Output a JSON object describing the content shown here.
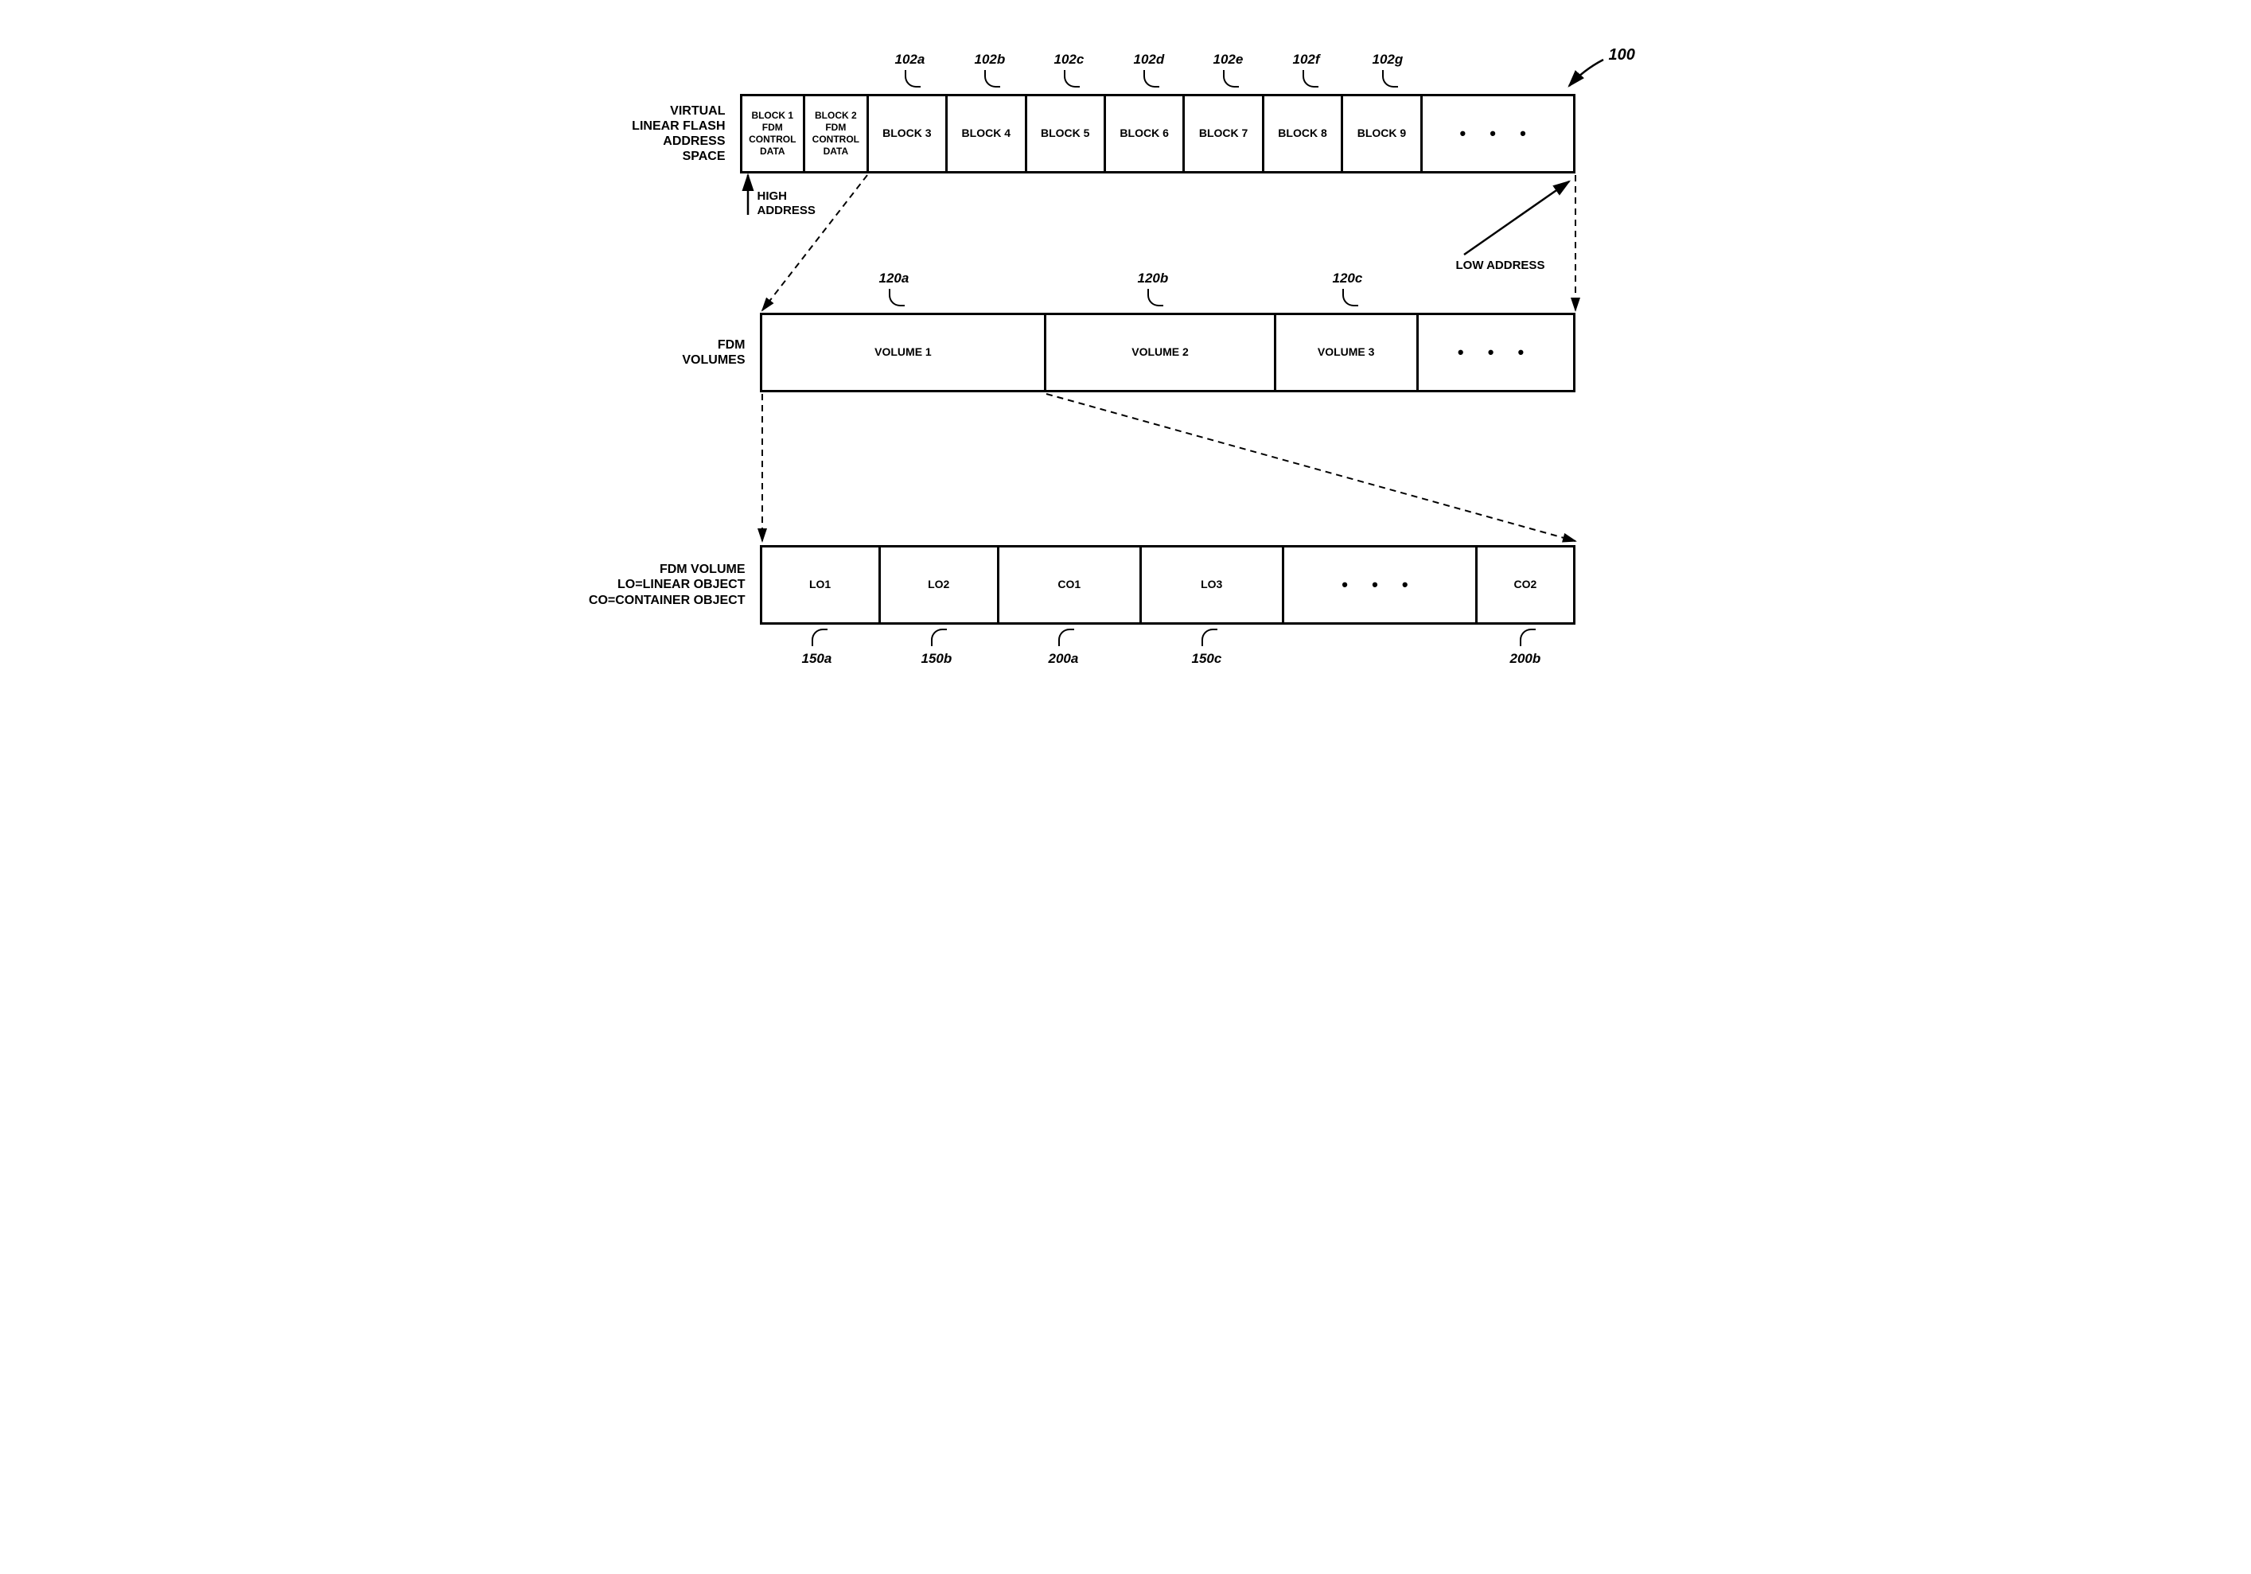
{
  "figure_ref": "100",
  "row1": {
    "label": "VIRTUAL\nLINEAR FLASH\nADDRESS\nSPACE",
    "cells": [
      "BLOCK 1\nFDM\nCONTROL\nDATA",
      "BLOCK 2\nFDM\nCONTROL\nDATA",
      "BLOCK 3",
      "BLOCK 4",
      "BLOCK 5",
      "BLOCK 6",
      "BLOCK 7",
      "BLOCK 8",
      "BLOCK 9"
    ],
    "callouts": [
      "102a",
      "102b",
      "102c",
      "102d",
      "102e",
      "102f",
      "102g"
    ],
    "high_addr": "HIGH\nADDRESS",
    "low_addr": "LOW ADDRESS"
  },
  "row2": {
    "label": "FDM\nVOLUMES",
    "cells": [
      "VOLUME 1",
      "VOLUME 2",
      "VOLUME 3"
    ],
    "callouts": [
      "120a",
      "120b",
      "120c"
    ]
  },
  "row3": {
    "label": "FDM VOLUME\nLO=LINEAR OBJECT\nCO=CONTAINER OBJECT",
    "cells": [
      "LO1",
      "LO2",
      "CO1",
      "LO3",
      "",
      "CO2"
    ],
    "callouts_below": [
      "150a",
      "150b",
      "200a",
      "150c",
      "200b"
    ]
  },
  "ellipsis": "•   •   •"
}
